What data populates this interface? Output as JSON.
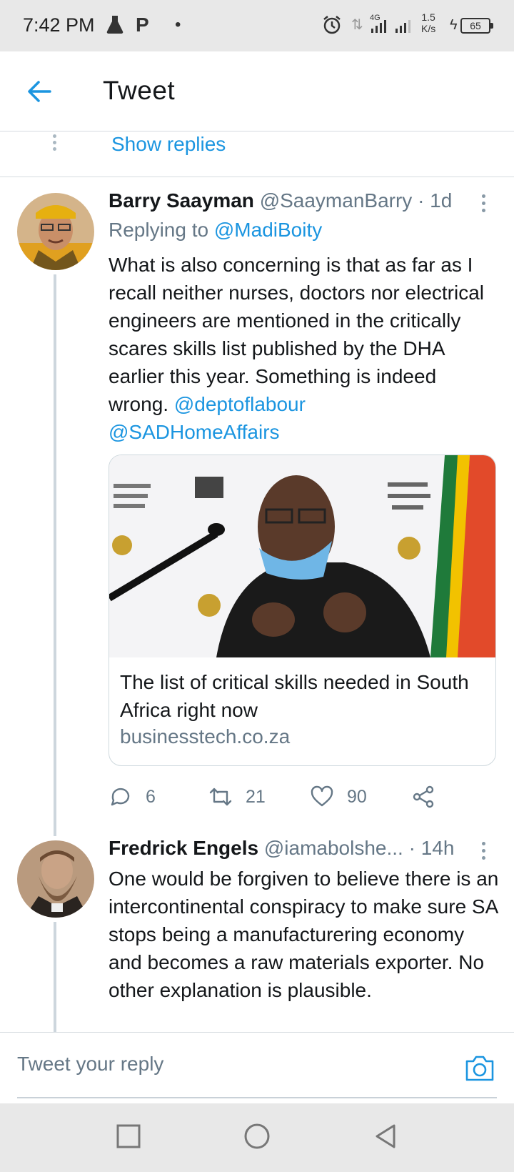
{
  "status_bar": {
    "time": "7:42 PM",
    "network": "4G",
    "speed_value": "1.5",
    "speed_unit": "K/s",
    "battery": "65"
  },
  "header": {
    "title": "Tweet",
    "back_icon": "arrow-left-icon"
  },
  "thread": {
    "show_replies": "Show replies"
  },
  "tweets": [
    {
      "name": "Barry Saayman",
      "handle": "@SaaymanBarry",
      "time": "· 1d",
      "replying_prefix": "Replying to",
      "replying_to": "@MadiBoity",
      "text": "What is also concerning is that as far as I recall neither nurses, doctors nor electrical engineers are mentioned in the critically scares skills list published by the DHA earlier this year. Something is indeed wrong.",
      "mentions": [
        "@deptoflabour",
        "@SADHomeAffairs"
      ],
      "card": {
        "title": "The list of critical skills needed in South Africa right now",
        "domain": "businesstech.co.za"
      },
      "replies": "6",
      "retweets": "21",
      "likes": "90"
    },
    {
      "name": "Fredrick Engels",
      "handle": "@iamabolshe...",
      "time": "· 14h",
      "text": "One would be forgiven to believe there is an intercontinental conspiracy to make sure SA stops being a manufacturering economy and becomes a raw materials exporter. No other explanation is plausible."
    }
  ],
  "reply_bar": {
    "placeholder": "Tweet your reply"
  },
  "colors": {
    "accent": "#1b95e0",
    "secondary_text": "#657786",
    "primary_text": "#14171a",
    "divider": "#d6dbe0"
  }
}
